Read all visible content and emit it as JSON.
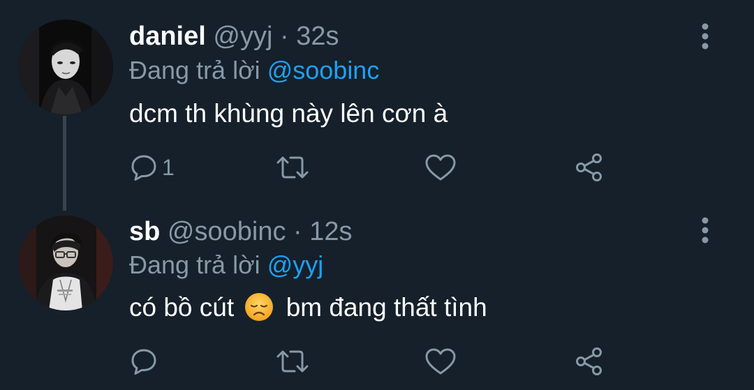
{
  "tweets": [
    {
      "display_name": "daniel",
      "handle": "@yyj",
      "separator": "·",
      "time": "32s",
      "replying_prefix": "Đang trả lời",
      "replying_to": "@soobinc",
      "text": "dcm th khùng này lên cơn à",
      "reply_count": "1",
      "avatar": "avatar-photo"
    },
    {
      "display_name": "sb",
      "handle": "@soobinc",
      "separator": "·",
      "time": "12s",
      "replying_prefix": "Đang trả lời",
      "replying_to": "@yyj",
      "text_before_emoji": "có bồ cút",
      "emoji": "disappointed-face-emoji",
      "text_after_emoji": "bm đang thất tình",
      "reply_count": "",
      "avatar": "avatar-photo"
    }
  ],
  "icons": {
    "more": "more-vertical-icon",
    "reply": "reply-bubble-icon",
    "retweet": "retweet-icon",
    "like": "heart-icon",
    "share": "share-icon"
  },
  "colors": {
    "background": "#15202b",
    "primary_text": "#ffffff",
    "secondary_text": "#8899a6",
    "accent": "#1da1f2",
    "thread_line": "#38444d"
  }
}
